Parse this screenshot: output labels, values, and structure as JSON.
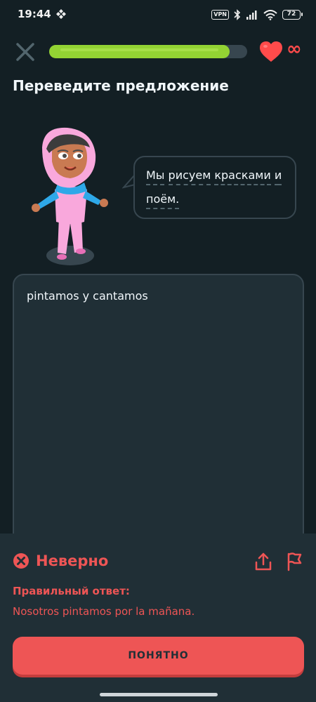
{
  "status_bar": {
    "time": "19:44",
    "vpn": "VPN",
    "battery": "72"
  },
  "lesson": {
    "progress_fraction": 0.91,
    "hearts": "∞",
    "instruction": "Переведите предложение"
  },
  "prompt": {
    "line1_words": [
      "Мы",
      "рисуем",
      "красками",
      "и"
    ],
    "line2_words": [
      "поём."
    ]
  },
  "answer": {
    "text": "pintamos y cantamos"
  },
  "feedback": {
    "title": "Неверно",
    "correct_label": "Правильный ответ:",
    "correct_answer": "Nosotros pintamos por la mañana.",
    "continue_label": "ПОНЯТНО"
  },
  "colors": {
    "background": "#131f24",
    "panel": "#202f36",
    "border": "#37464f",
    "progress": "#93d333",
    "error": "#ee5555",
    "heart": "#ff4b4b"
  }
}
